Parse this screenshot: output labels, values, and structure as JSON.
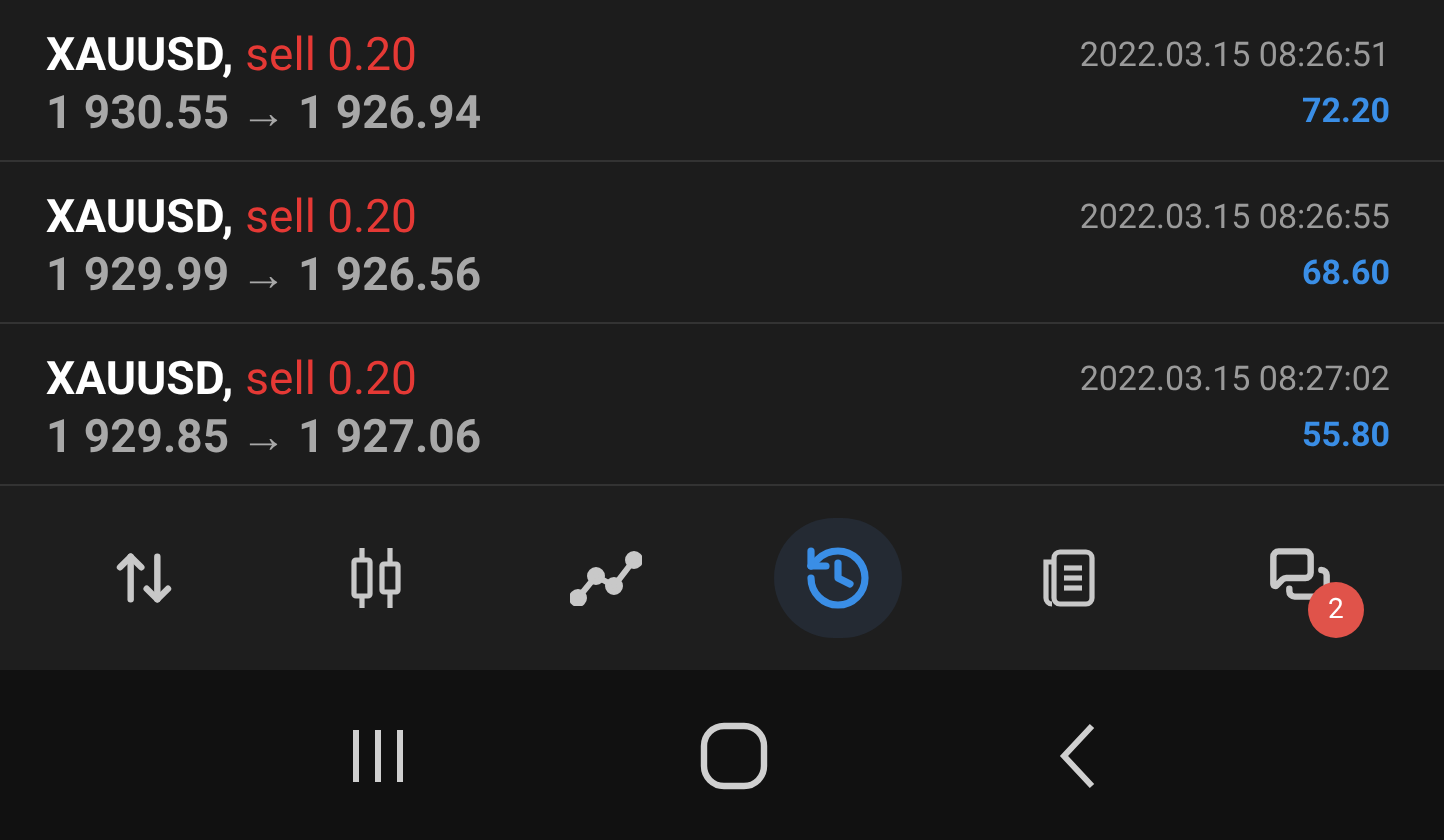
{
  "trades": [
    {
      "symbol": "XAUUSD,",
      "side": "sell 0.20",
      "prices": "1 930.55 → 1 926.94",
      "time": "2022.03.15 08:26:51",
      "profit": "72.20"
    },
    {
      "symbol": "XAUUSD,",
      "side": "sell 0.20",
      "prices": "1 929.99 → 1 926.56",
      "time": "2022.03.15 08:26:55",
      "profit": "68.60"
    },
    {
      "symbol": "XAUUSD,",
      "side": "sell 0.20",
      "prices": "1 929.85 → 1 927.06",
      "time": "2022.03.15 08:27:02",
      "profit": "55.80"
    }
  ],
  "bottom_nav": [
    {
      "kind": "quotes",
      "selected": false
    },
    {
      "kind": "chart",
      "selected": false
    },
    {
      "kind": "trade",
      "selected": false
    },
    {
      "kind": "history",
      "selected": true
    },
    {
      "kind": "journal",
      "selected": false
    },
    {
      "kind": "messages",
      "selected": false,
      "badge": "2"
    }
  ]
}
